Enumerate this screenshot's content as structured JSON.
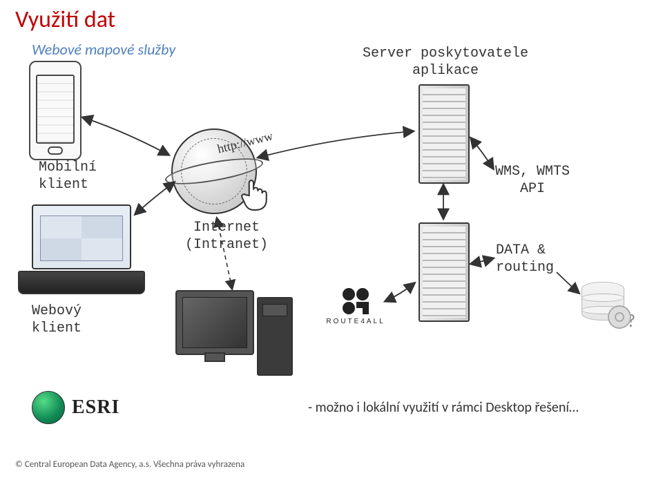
{
  "title": "Využití dat",
  "subtitle": "Webové mapové služby",
  "labels": {
    "server": "Server poskytovatele\naplikace",
    "mobile": "Mobilní\nklient",
    "internet": "Internet\n(Intranet)",
    "wms": "WMS, WMTS\nAPI",
    "data_routing": "DATA &\nrouting",
    "web_client": "Webový\nklient",
    "http": "http://www"
  },
  "brands": {
    "route4all": "ROUTE4ALL",
    "esri": "ESRI"
  },
  "note": "- možno i lokální využití v rámci Desktop řešení…",
  "question_mark": "?",
  "footer": "© Central European Data Agency, a.s. Všechna práva vyhrazena"
}
